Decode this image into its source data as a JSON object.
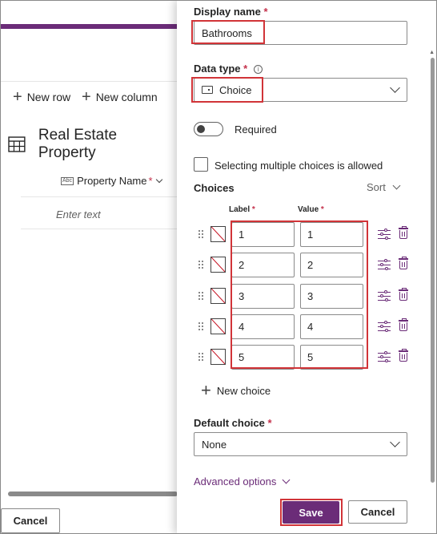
{
  "background": {
    "commands": {
      "new_row": "New row",
      "new_column": "New column"
    },
    "table_title": "Real Estate Property",
    "column_header": {
      "icon_text": "Abc",
      "label": "Property Name",
      "required_mark": "*"
    },
    "placeholder_cell": "Enter text",
    "cancel_label": "Cancel"
  },
  "panel": {
    "display_name": {
      "label": "Display name",
      "required_mark": "*",
      "value": "Bathrooms"
    },
    "data_type": {
      "label": "Data type",
      "required_mark": "*",
      "info_glyph": "i",
      "value": "Choice"
    },
    "required_label": "Required",
    "multi_select_label": "Selecting multiple choices is allowed",
    "choices_heading": "Choices",
    "sort_label": "Sort",
    "columns": {
      "label": "Label",
      "value": "Value",
      "required_mark": "*"
    },
    "choices": [
      {
        "label": "1",
        "value": "1"
      },
      {
        "label": "2",
        "value": "2"
      },
      {
        "label": "3",
        "value": "3"
      },
      {
        "label": "4",
        "value": "4"
      },
      {
        "label": "5",
        "value": "5"
      }
    ],
    "new_choice_label": "New choice",
    "default_choice": {
      "label": "Default choice",
      "required_mark": "*",
      "value": "None"
    },
    "advanced_options_label": "Advanced options",
    "save_label": "Save",
    "cancel_label": "Cancel"
  },
  "colors": {
    "accent": "#6b2c78",
    "highlight": "#d13438",
    "required": "#c4314b"
  }
}
